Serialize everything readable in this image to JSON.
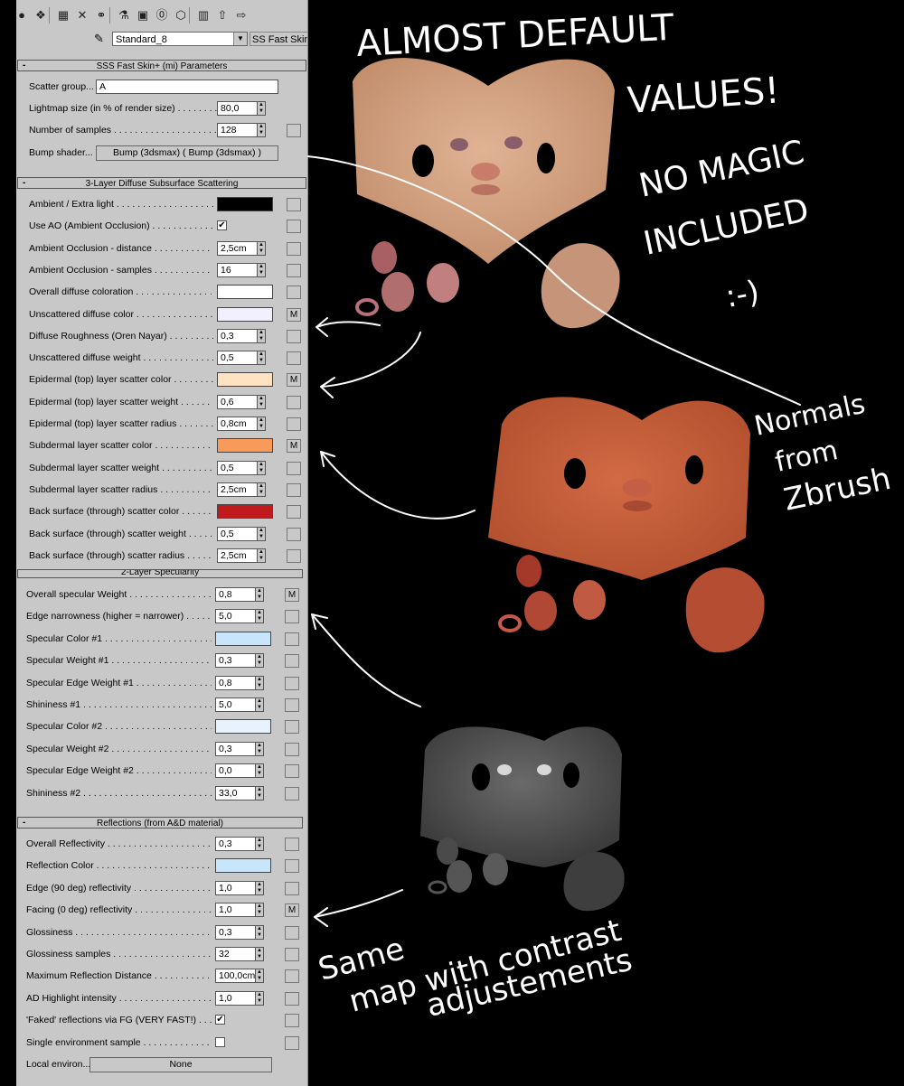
{
  "toolbar": {
    "icons": [
      "sphere-icon",
      "pick-material-icon",
      "put-to-scene-icon",
      "delete-icon",
      "make-unique-icon",
      "put-to-library-icon",
      "material-id-icon",
      "show-map-icon",
      "background-icon",
      "show-end-result-icon",
      "go-to-parent-icon",
      "go-forward-icon"
    ]
  },
  "material": {
    "name": "Standard_8",
    "type": "SS Fast Skin+ (mi)"
  },
  "sss_params": {
    "title": "SSS Fast Skin+ (mi) Parameters",
    "scatter_group_label": "Scatter group...",
    "scatter_group_value": "A",
    "lightmap_label": "Lightmap size (in % of render size) . . . . . . . . .",
    "lightmap_value": "80,0",
    "samples_label": "Number of samples . . . . . . . . . . . . . . . . . . . . .",
    "samples_value": "128",
    "bump_label": "Bump shader...",
    "bump_value": "Bump (3dsmax)  ( Bump (3dsmax) )"
  },
  "diffuse": {
    "title": "3-Layer Diffuse Subsurface Scattering",
    "rows": [
      {
        "label": "Ambient / Extra light . . . . . . . . . . . . . . . . . . . .",
        "kind": "swatch",
        "color": "#000000"
      },
      {
        "label": "Use AO (Ambient Occlusion) . . . . . . . . . . . . . . .",
        "kind": "check",
        "checked": "✔"
      },
      {
        "label": "Ambient Occlusion - distance . . . . . . . . . . . . . .",
        "kind": "spin",
        "value": "2,5cm"
      },
      {
        "label": "Ambient Occlusion - samples . . . . . . . . . . . . . . .",
        "kind": "spin",
        "value": "16"
      },
      {
        "label": "Overall diffuse coloration . . . . . . . . . . . . . . . . .",
        "kind": "swatch",
        "color": "#ffffff"
      },
      {
        "label": "Unscattered diffuse color . . . . . . . . . . . . . . . . .",
        "kind": "swatch",
        "color": "#f2f0ff",
        "map": "M"
      },
      {
        "label": "Diffuse Roughness (Oren Nayar) . . . . . . . . . . . .",
        "kind": "spin",
        "value": "0,3"
      },
      {
        "label": "Unscattered diffuse weight . . . . . . . . . . . . . . . .",
        "kind": "spin",
        "value": "0,5"
      },
      {
        "label": "Epidermal (top) layer scatter color . . . . . . . . . . .",
        "kind": "swatch",
        "color": "#ffe2c2",
        "map": "M"
      },
      {
        "label": "Epidermal (top) layer scatter weight . . . . . . . . . .",
        "kind": "spin",
        "value": "0,6"
      },
      {
        "label": "Epidermal (top) layer scatter radius . . . . . . . . . .",
        "kind": "spin",
        "value": "0,8cm"
      },
      {
        "label": "Subdermal layer scatter color . . . . . . . . . . . . . .",
        "kind": "swatch",
        "color": "#f79a5a",
        "map": "M"
      },
      {
        "label": "Subdermal layer scatter weight . . . . . . . . . . . . .",
        "kind": "spin",
        "value": "0,5"
      },
      {
        "label": "Subdermal layer scatter radius . . . . . . . . . . . . .",
        "kind": "spin",
        "value": "2,5cm"
      },
      {
        "label": "Back surface (through) scatter color . . . . . . . . . .",
        "kind": "swatch",
        "color": "#c0191e"
      },
      {
        "label": "Back surface (through) scatter weight . . . . . . . . .",
        "kind": "spin",
        "value": "0,5"
      },
      {
        "label": "Back surface (through) scatter radius . . . . . . . . .",
        "kind": "spin",
        "value": "2,5cm"
      }
    ]
  },
  "specular": {
    "title": "2-Layer Specularity",
    "rows": [
      {
        "label": "Overall specular Weight . . . . . . . . . . . . . . . . . .",
        "kind": "spin",
        "value": "0,8",
        "map": "M"
      },
      {
        "label": "Edge narrowness (higher = narrower) . . . . . . . . .",
        "kind": "spin",
        "value": "5,0"
      },
      {
        "label": "Specular Color #1 . . . . . . . . . . . . . . . . . . . . . . .",
        "kind": "swatch",
        "color": "#c7e5fb"
      },
      {
        "label": "Specular Weight #1 . . . . . . . . . . . . . . . . . . . . . .",
        "kind": "spin",
        "value": "0,3"
      },
      {
        "label": "Specular Edge Weight #1 . . . . . . . . . . . . . . . . .",
        "kind": "spin",
        "value": "0,8"
      },
      {
        "label": "Shininess #1 . . . . . . . . . . . . . . . . . . . . . . . . . . .",
        "kind": "spin",
        "value": "5,0"
      },
      {
        "label": "Specular Color #2 . . . . . . . . . . . . . . . . . . . . . . .",
        "kind": "swatch",
        "color": "#e8f2fc"
      },
      {
        "label": "Specular Weight #2 . . . . . . . . . . . . . . . . . . . . . .",
        "kind": "spin",
        "value": "0,3"
      },
      {
        "label": "Specular Edge Weight #2 . . . . . . . . . . . . . . . . .",
        "kind": "spin",
        "value": "0,0"
      },
      {
        "label": "Shininess #2 . . . . . . . . . . . . . . . . . . . . . . . . . . .",
        "kind": "spin",
        "value": "33,0"
      }
    ]
  },
  "reflections": {
    "title": "Reflections (from A&D material)",
    "rows": [
      {
        "label": "Overall Reflectivity . . . . . . . . . . . . . . . . . . . . . .",
        "kind": "spin",
        "value": "0,3"
      },
      {
        "label": "Reflection Color . . . . . . . . . . . . . . . . . . . . . . . .",
        "kind": "swatch",
        "color": "#c7e5fb"
      },
      {
        "label": "Edge (90 deg) reflectivity . . . . . . . . . . . . . . . . .",
        "kind": "spin",
        "value": "1,0"
      },
      {
        "label": "Facing (0 deg) reflectivity . . . . . . . . . . . . . . . . .",
        "kind": "spin",
        "value": "1,0",
        "map": "M"
      },
      {
        "label": "Glossiness . . . . . . . . . . . . . . . . . . . . . . . . . . . .",
        "kind": "spin",
        "value": "0,3"
      },
      {
        "label": "Glossiness samples . . . . . . . . . . . . . . . . . . . . . .",
        "kind": "spin",
        "value": "32"
      },
      {
        "label": "Maximum Reflection Distance . . . . . . . . . . . . . .",
        "kind": "spin",
        "value": "100,0cm"
      },
      {
        "label": "AD Highlight intensity . . . . . . . . . . . . . . . . . . . .",
        "kind": "spin",
        "value": "1,0"
      },
      {
        "label": "'Faked' reflections via FG (VERY FAST!) . . .",
        "kind": "check",
        "checked": "✔"
      },
      {
        "label": "Single environment sample . . . . . . . . . . . . . . . .",
        "kind": "check",
        "checked": ""
      },
      {
        "label": "Local environ...",
        "kind": "button",
        "value": "None"
      }
    ]
  },
  "annotations": {
    "line1": "ALMOST DEFAULT",
    "line2": "VALUES!",
    "line3": "NO MAGIC",
    "line4": "INCLUDED",
    "smiley": ":-)",
    "normals1": "Normals",
    "normals2": "from",
    "normals3": "Zbrush",
    "same1": "Same",
    "same2": "map with contrast",
    "same3": "adjustements"
  }
}
